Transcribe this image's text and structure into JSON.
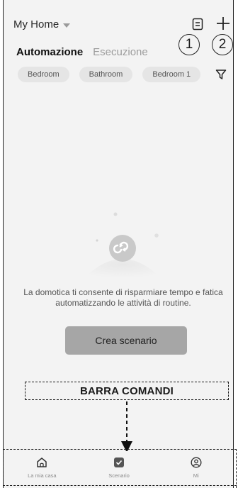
{
  "header": {
    "home_title": "My Home",
    "callout_1": "1",
    "callout_2": "2"
  },
  "tabs": [
    {
      "label": "Automazione",
      "active": true
    },
    {
      "label": "Esecuzione",
      "active": false
    }
  ],
  "rooms": [
    "Bedroom",
    "Bathroom",
    "Bedroom 1"
  ],
  "empty_state": {
    "text": "La domotica ti consente di risparmiare tempo e fatica automatizzando le attività di routine.",
    "button_label": "Crea scenario"
  },
  "annotation": {
    "command_bar_label": "BARRA COMANDI"
  },
  "tabbar": [
    {
      "label": "La mia casa",
      "icon": "home-icon"
    },
    {
      "label": "Scenario",
      "icon": "scenario-icon"
    },
    {
      "label": "Mi",
      "icon": "profile-icon"
    }
  ],
  "colors": {
    "background": "#f3f3f3",
    "button": "#a6a6a6",
    "chip": "#e5e5e5"
  }
}
